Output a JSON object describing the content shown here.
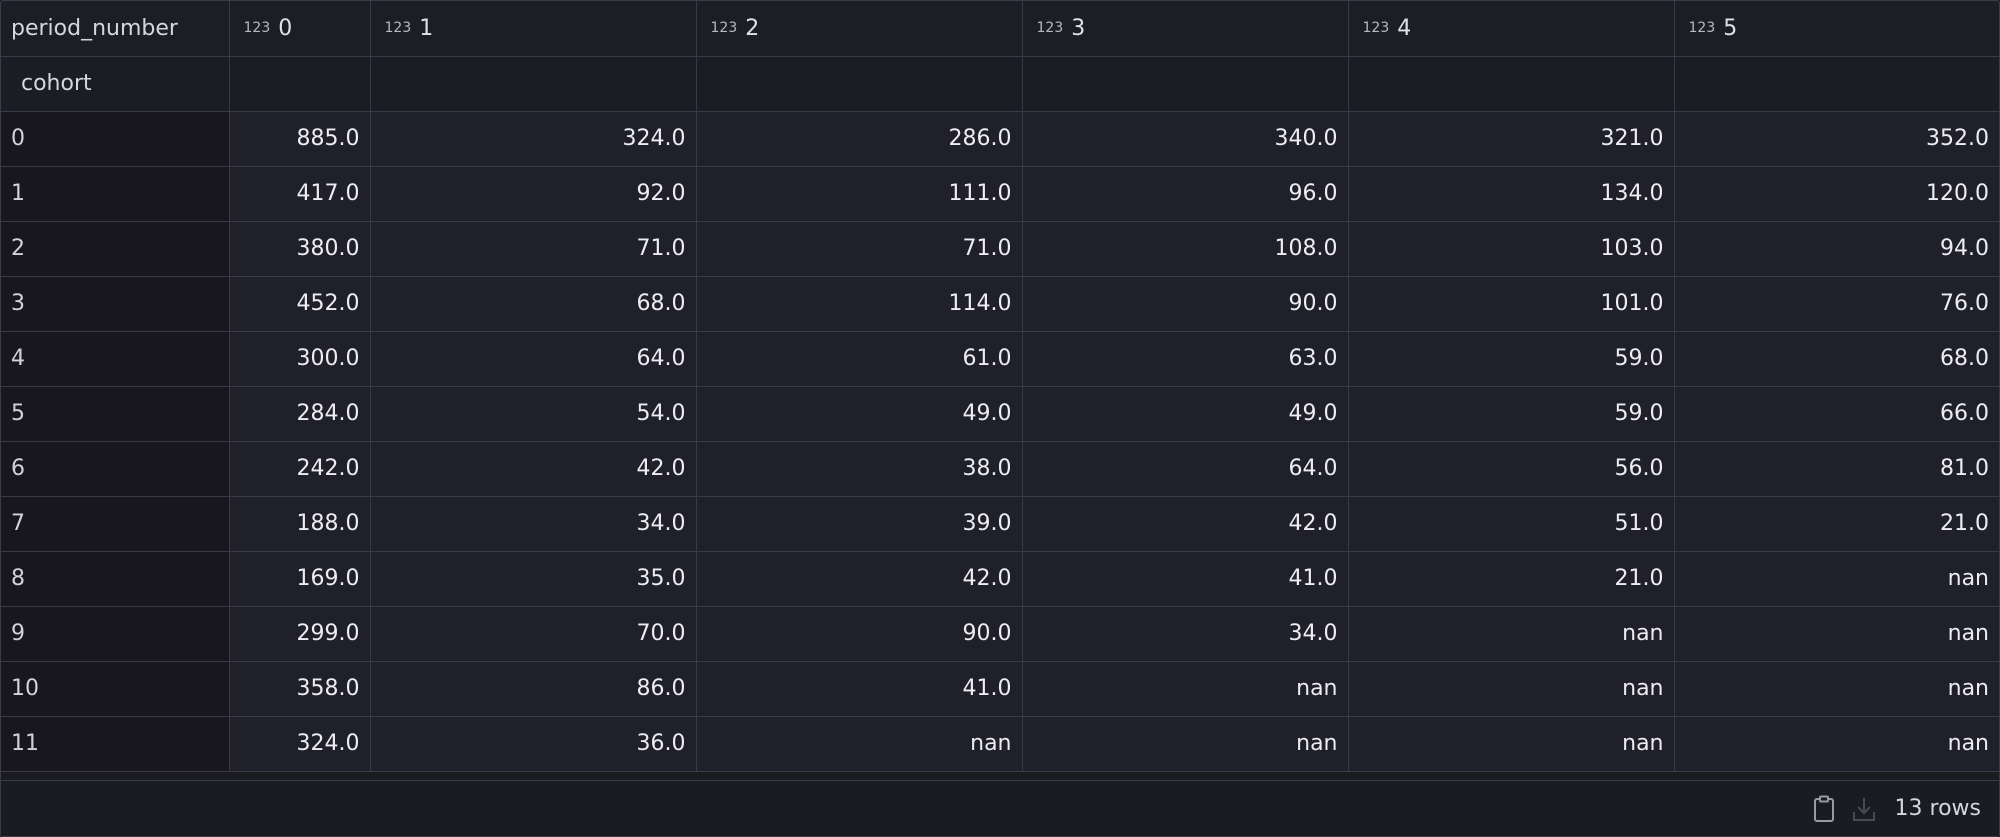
{
  "table": {
    "index_name": "period_number",
    "row_index_label": "cohort",
    "type_tag": "123",
    "columns": [
      "0",
      "1",
      "2",
      "3",
      "4",
      "5"
    ],
    "rows": [
      {
        "index": "0",
        "cells": [
          "885.0",
          "324.0",
          "286.0",
          "340.0",
          "321.0",
          "352.0"
        ]
      },
      {
        "index": "1",
        "cells": [
          "417.0",
          "92.0",
          "111.0",
          "96.0",
          "134.0",
          "120.0"
        ]
      },
      {
        "index": "2",
        "cells": [
          "380.0",
          "71.0",
          "71.0",
          "108.0",
          "103.0",
          "94.0"
        ]
      },
      {
        "index": "3",
        "cells": [
          "452.0",
          "68.0",
          "114.0",
          "90.0",
          "101.0",
          "76.0"
        ]
      },
      {
        "index": "4",
        "cells": [
          "300.0",
          "64.0",
          "61.0",
          "63.0",
          "59.0",
          "68.0"
        ]
      },
      {
        "index": "5",
        "cells": [
          "284.0",
          "54.0",
          "49.0",
          "49.0",
          "59.0",
          "66.0"
        ]
      },
      {
        "index": "6",
        "cells": [
          "242.0",
          "42.0",
          "38.0",
          "64.0",
          "56.0",
          "81.0"
        ]
      },
      {
        "index": "7",
        "cells": [
          "188.0",
          "34.0",
          "39.0",
          "42.0",
          "51.0",
          "21.0"
        ]
      },
      {
        "index": "8",
        "cells": [
          "169.0",
          "35.0",
          "42.0",
          "41.0",
          "21.0",
          "nan"
        ]
      },
      {
        "index": "9",
        "cells": [
          "299.0",
          "70.0",
          "90.0",
          "34.0",
          "nan",
          "nan"
        ]
      },
      {
        "index": "10",
        "cells": [
          "358.0",
          "86.0",
          "41.0",
          "nan",
          "nan",
          "nan"
        ]
      },
      {
        "index": "11",
        "cells": [
          "324.0",
          "36.0",
          "nan",
          "nan",
          "nan",
          "nan"
        ]
      }
    ]
  },
  "footer": {
    "copy_icon": "clipboard-icon",
    "download_icon": "download-icon",
    "row_count": "13 rows"
  },
  "colors": {
    "background": "#1b1b22",
    "cell_background": "#20202a",
    "index_background": "#17171d",
    "border": "#3a3a46",
    "text": "#ececf2"
  }
}
